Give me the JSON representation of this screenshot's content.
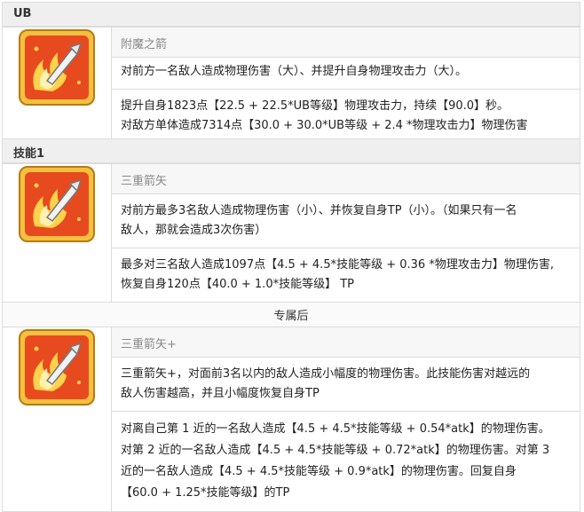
{
  "ub": {
    "header": "UB",
    "icon": "flaming-arrow-icon",
    "name": "附魔之箭",
    "desc": "对前方一名敌人造成物理伤害（大）、并提升自身物理攻击力（大）。",
    "detail_lines": [
      "提升自身1823点【22.5 + 22.5*UB等级】物理攻击力，持续【90.0】秒。",
      "对敌方单体造成7314点【30.0 + 30.0*UB等级 + 2.4 *物理攻击力】物理伤害"
    ]
  },
  "skill1": {
    "header": "技能1",
    "icon": "flaming-arrow-icon",
    "name": "三重箭矢",
    "desc_lines": [
      "对前方最多3名敌人造成物理伤害（小）、并恢复自身TP（小）。（如果只有一名",
      "敌人，那就会造成3次伤害）"
    ],
    "detail_lines": [
      "最多对三名敌人造成1097点【4.5 + 4.5*技能等级 + 0.36 *物理攻击力】物理伤害,",
      "恢复自身120点【40.0 + 1.0*技能等级】 TP"
    ],
    "divider": "专属后"
  },
  "skill1_plus": {
    "icon": "flaming-arrow-icon",
    "name": "三重箭矢+",
    "desc_lines": [
      "三重箭矢+，对面前3名以内的敌人造成小幅度的物理伤害。此技能伤害对越远的",
      "敌人伤害越高，并且小幅度恢复自身TP"
    ],
    "detail_lines": [
      "对离自己第 1 近的一名敌人造成【4.5 + 4.5*技能等级 + 0.54*atk】的物理伤害。",
      "对第 2 近的一名敌人造成【4.5 + 4.5*技能等级 + 0.72*atk】的物理伤害。对第 3",
      "近的一名敌人造成【4.5 + 4.5*技能等级 + 0.9*atk】的物理伤害。回复自身",
      "【60.0 + 1.25*技能等级】的TP"
    ]
  },
  "colors": {
    "icon_border": "#e0a020",
    "icon_bg": "#e84a20",
    "flame": "#ffd24a",
    "header_bg": "#efefef",
    "grid": "#dcdcdc"
  }
}
